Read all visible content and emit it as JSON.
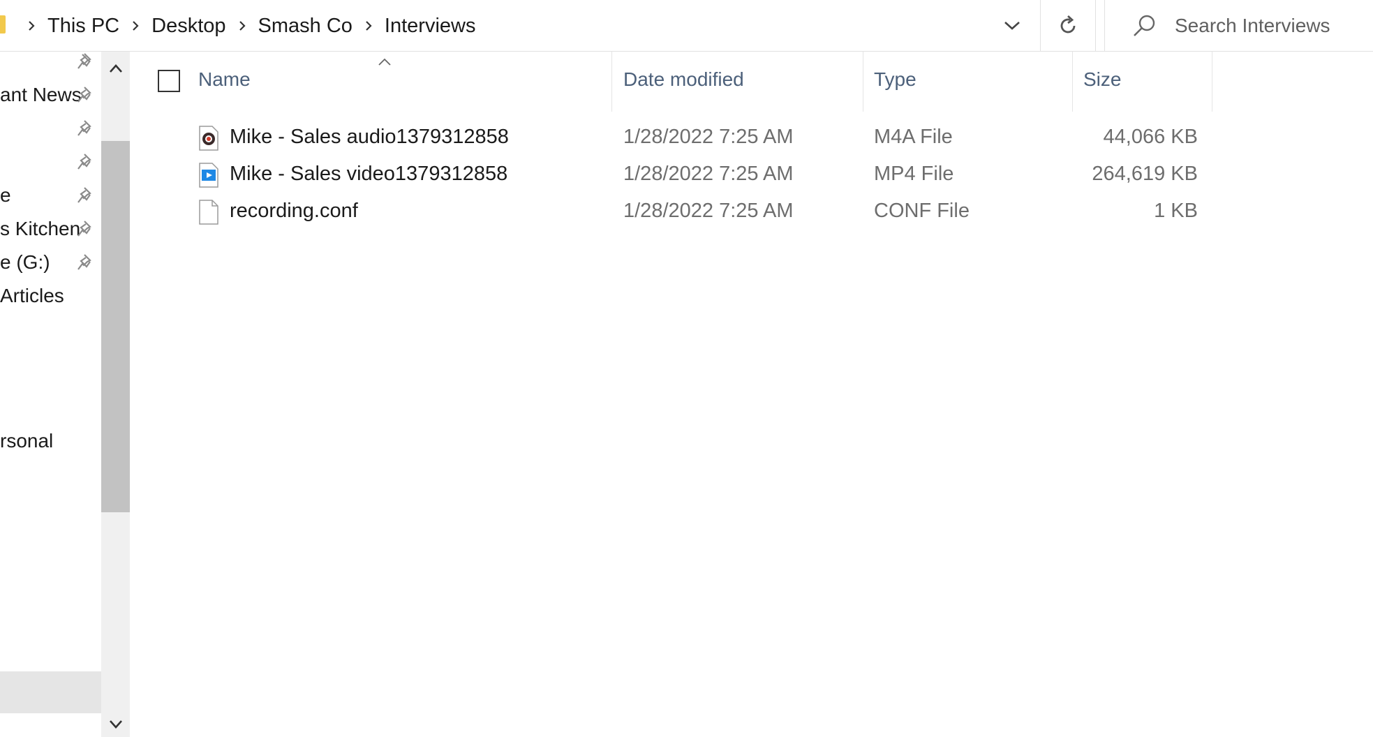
{
  "address_bar": {
    "breadcrumbs": [
      "This PC",
      "Desktop",
      "Smash Co",
      "Interviews"
    ]
  },
  "search": {
    "placeholder": "Search Interviews"
  },
  "nav_pane": {
    "items": [
      {
        "label": "",
        "pinned": true
      },
      {
        "label": "ant News",
        "pinned": true
      },
      {
        "label": "",
        "pinned": true
      },
      {
        "label": "",
        "pinned": true
      },
      {
        "label": "e",
        "pinned": true
      },
      {
        "label": "s Kitchen",
        "pinned": true
      },
      {
        "label": "e (G:)",
        "pinned": true
      },
      {
        "label": " Articles",
        "pinned": false
      },
      {
        "label": "rsonal",
        "pinned": false
      }
    ]
  },
  "columns": {
    "name": "Name",
    "date": "Date modified",
    "type": "Type",
    "size": "Size"
  },
  "files": [
    {
      "name": "Mike - Sales audio1379312858",
      "date": "1/28/2022 7:25 AM",
      "type": "M4A File",
      "size": "44,066 KB",
      "icon": "audio-file-icon"
    },
    {
      "name": "Mike - Sales video1379312858",
      "date": "1/28/2022 7:25 AM",
      "type": "MP4 File",
      "size": "264,619 KB",
      "icon": "video-file-icon"
    },
    {
      "name": "recording.conf",
      "date": "1/28/2022 7:25 AM",
      "type": "CONF File",
      "size": "1 KB",
      "icon": "blank-file-icon"
    }
  ],
  "colors": {
    "header_text": "#4c607a",
    "secondary_text": "#6d6d6d",
    "folder": "#f2c94c",
    "video_icon": "#1e88e5"
  }
}
